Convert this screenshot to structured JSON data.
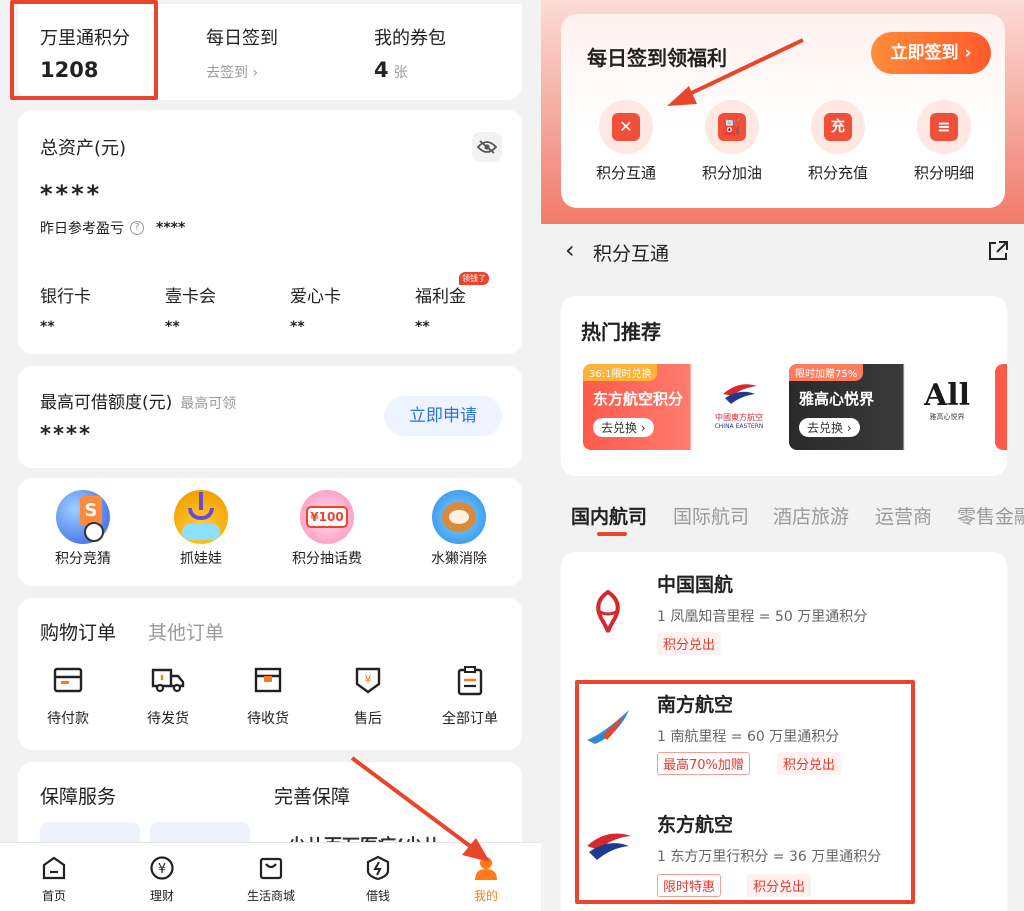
{
  "left": {
    "stats": [
      {
        "label": "万里通积分",
        "value": "1208"
      },
      {
        "label": "每日签到",
        "sub": "去签到 ›"
      },
      {
        "label": "我的券包",
        "value": "4",
        "unit": "张"
      }
    ],
    "assets": {
      "title": "总资产(元)",
      "amount": "****",
      "yesterday_label": "昨日参考盈亏",
      "yesterday_value": "****",
      "items": [
        {
          "label": "银行卡",
          "value": "**"
        },
        {
          "label": "壹卡会",
          "value": "**"
        },
        {
          "label": "爱心卡",
          "value": "**"
        },
        {
          "label": "福利金",
          "value": "**",
          "badge": "领钱了"
        }
      ]
    },
    "loan": {
      "title": "最高可借额度(元)",
      "sub": "最高可领",
      "amount": "****",
      "button": "立即申请"
    },
    "games": [
      {
        "label": "积分竞猜",
        "icon": "ball-icon"
      },
      {
        "label": "抓娃娃",
        "icon": "claw-icon"
      },
      {
        "label": "积分抽话费",
        "icon": "coupon-icon",
        "coupon": "¥100"
      },
      {
        "label": "水獭消除",
        "icon": "otter-icon"
      }
    ],
    "orders": {
      "tab_active": "购物订单",
      "tab_other": "其他订单",
      "items": [
        {
          "label": "待付款",
          "icon": "wallet-icon"
        },
        {
          "label": "待发货",
          "icon": "truck-icon"
        },
        {
          "label": "待收货",
          "icon": "box-icon"
        },
        {
          "label": "售后",
          "icon": "aftersale-icon"
        },
        {
          "label": "全部订单",
          "icon": "clipboard-icon"
        }
      ]
    },
    "protect": {
      "title": "保障服务",
      "title2": "完善保障",
      "partial_text": "少儿百万医疗(少儿"
    },
    "tabbar": [
      {
        "label": "首页",
        "icon": "home-icon"
      },
      {
        "label": "理财",
        "icon": "finance-icon"
      },
      {
        "label": "生活商城",
        "icon": "shop-icon"
      },
      {
        "label": "借钱",
        "icon": "loan-icon"
      },
      {
        "label": "我的",
        "icon": "user-icon",
        "active": true
      }
    ]
  },
  "right": {
    "signin": {
      "title": "每日签到领福利",
      "button": "立即签到 ›"
    },
    "quick": [
      {
        "label": "积分互通",
        "icon": "exchange-icon",
        "glyph": "✕"
      },
      {
        "label": "积分加油",
        "icon": "fuel-icon",
        "glyph": "⛽"
      },
      {
        "label": "积分充值",
        "icon": "recharge-icon",
        "glyph": "充"
      },
      {
        "label": "积分明细",
        "icon": "detail-icon",
        "glyph": "≡"
      }
    ],
    "nav": {
      "title": "积分互通"
    },
    "hot": {
      "title": "热门推荐",
      "cards": [
        {
          "tag": "36:1限时兑换",
          "name": "东方航空积分",
          "btn": "去兑换 ›",
          "logo_text": "中國東方航空",
          "logo_sub": "CHINA EASTERN"
        },
        {
          "tag": "限时加赠75%",
          "name": "雅高心悦界",
          "btn": "去兑换 ›",
          "logo_text": "All",
          "logo_sub": "雅高心悦界"
        }
      ]
    },
    "tabs": [
      "国内航司",
      "国际航司",
      "酒店旅游",
      "运营商",
      "零售金融"
    ],
    "airlines": [
      {
        "name": "中国国航",
        "rate": "1 凤凰知音里程 = 50 万里通积分",
        "tags": [
          "积分兑出"
        ],
        "icon": "air-china-logo"
      },
      {
        "name": "南方航空",
        "rate": "1 南航里程 = 60 万里通积分",
        "tags": [
          "最高70%加赠",
          "积分兑出"
        ],
        "icon": "china-southern-logo"
      },
      {
        "name": "东方航空",
        "rate": "1 东方万里行积分 = 36 万里通积分",
        "tags": [
          "限时特惠",
          "积分兑出"
        ],
        "icon": "china-eastern-logo"
      }
    ]
  },
  "colors": {
    "accent": "#e8452c",
    "orange": "#ff7a1a",
    "blue": "#2a73d9"
  }
}
